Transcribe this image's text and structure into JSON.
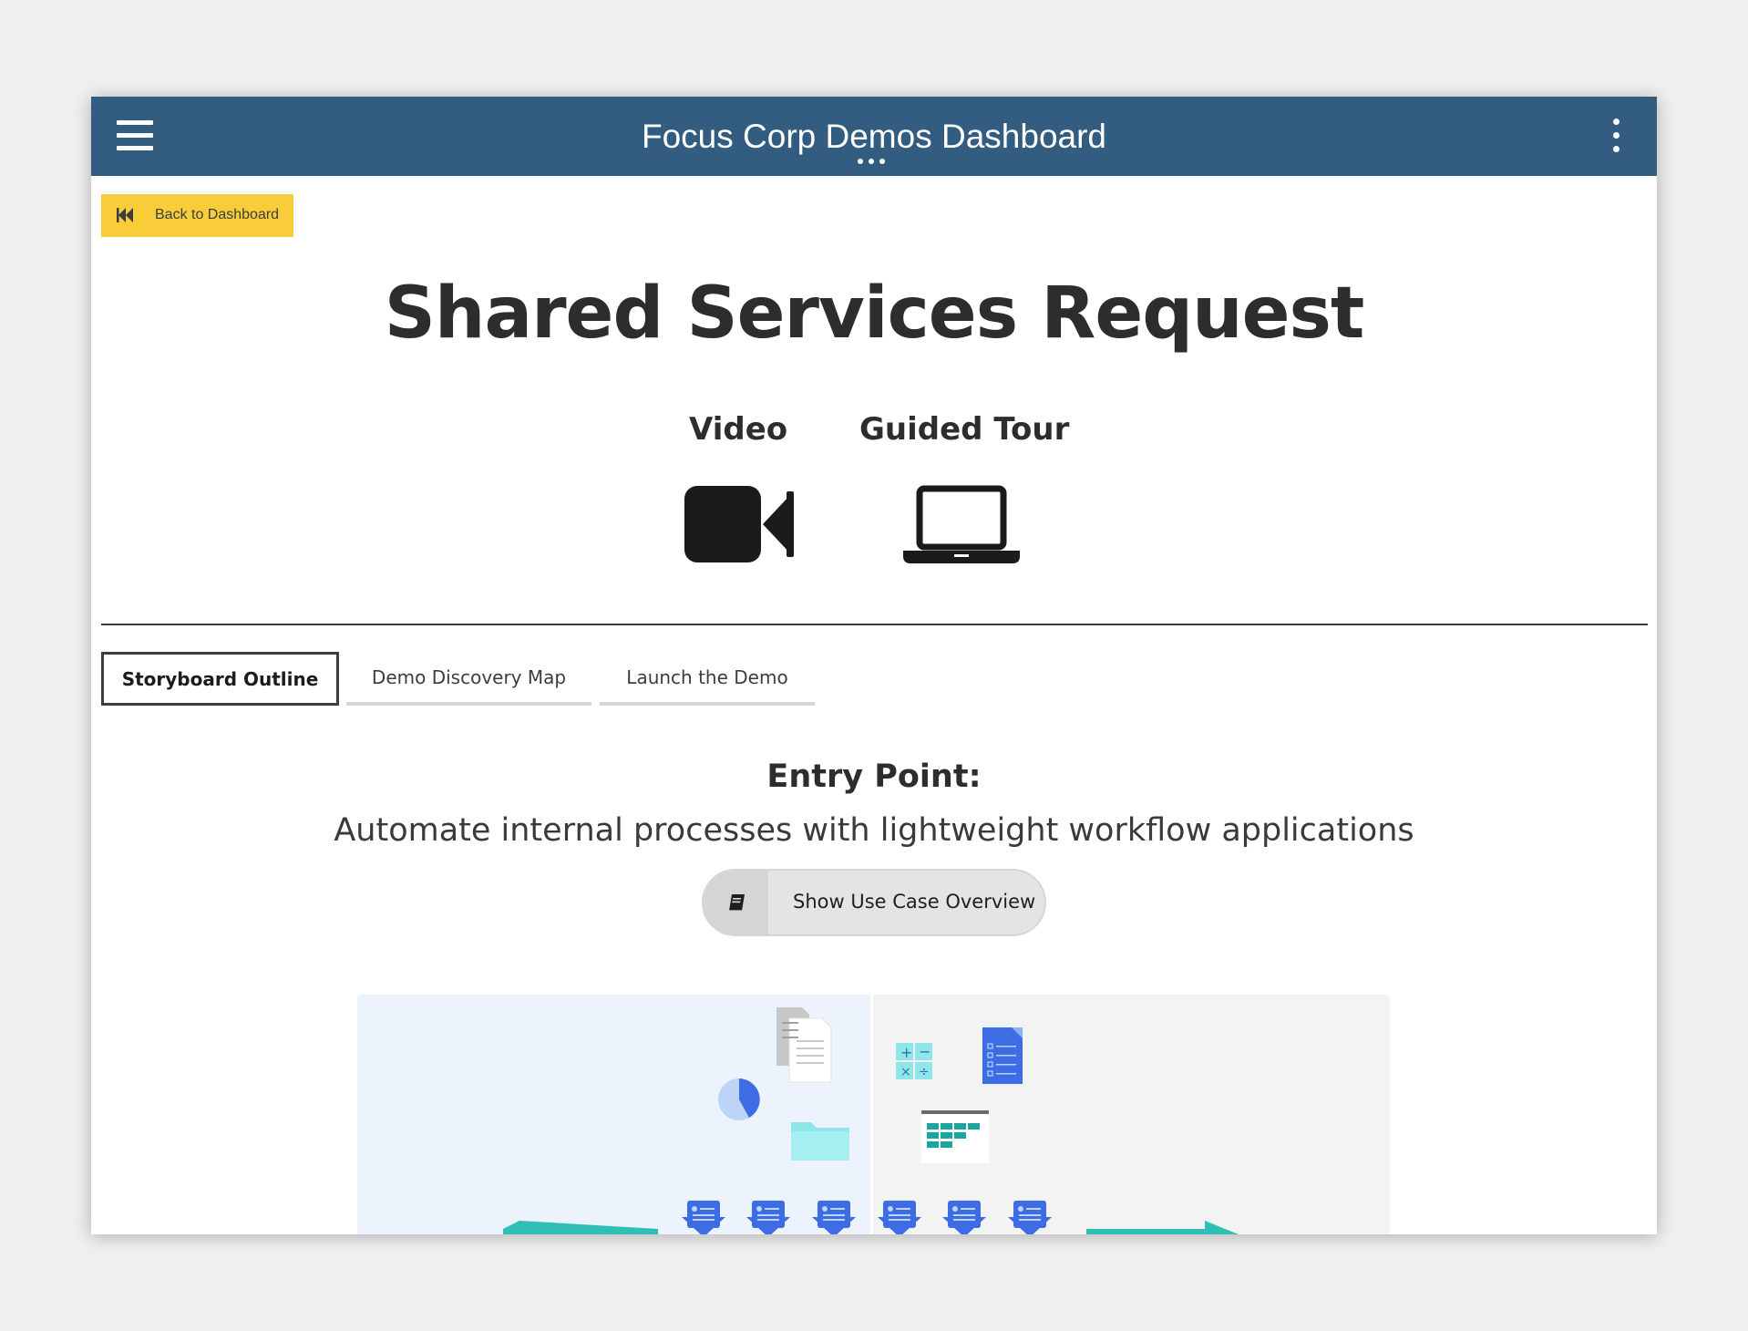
{
  "header": {
    "title": "Focus Corp Demos Dashboard",
    "menu_icon": "hamburger-menu-icon",
    "overflow_icon": "kebab-menu-icon",
    "background_color": "#325c80"
  },
  "back_button": {
    "label": "Back to Dashboard",
    "icon": "double-chevron-left-icon",
    "color": "#f8cd39"
  },
  "page": {
    "title": "Shared Services Request"
  },
  "media": {
    "video_label": "Video",
    "video_icon": "video-camera-icon",
    "tour_label": "Guided Tour",
    "tour_icon": "laptop-icon"
  },
  "tabs": [
    {
      "label": "Storyboard Outline",
      "active": true
    },
    {
      "label": "Demo Discovery Map",
      "active": false
    },
    {
      "label": "Launch the Demo",
      "active": false
    }
  ],
  "entry": {
    "heading": "Entry Point:",
    "subtitle": "Automate internal processes with lightweight workflow applications"
  },
  "usecase_button": {
    "label": "Show Use Case Overview",
    "icon": "book-icon"
  }
}
